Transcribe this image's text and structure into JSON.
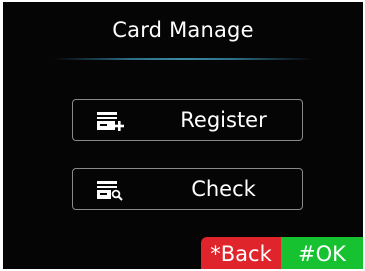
{
  "screen": {
    "title": "Card Manage"
  },
  "menu": {
    "items": [
      {
        "label": "Register",
        "icon": "card-add-icon"
      },
      {
        "label": "Check",
        "icon": "card-search-icon"
      }
    ]
  },
  "softkeys": {
    "back_label": "*Back",
    "ok_label": "#OK",
    "back_color": "#e0242b",
    "ok_color": "#16c230"
  }
}
